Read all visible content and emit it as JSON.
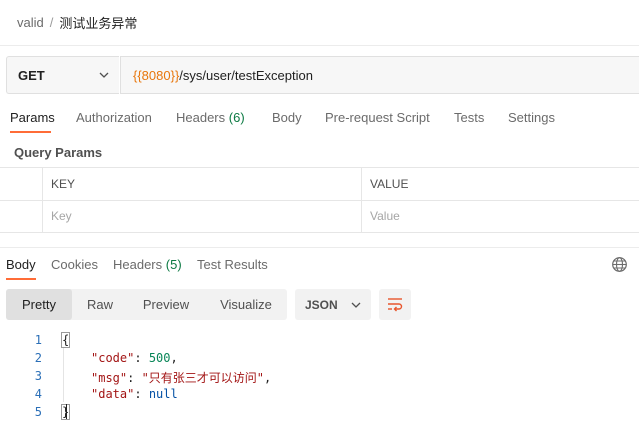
{
  "breadcrumb": {
    "parent": "valid",
    "separator": "/",
    "current": "测试业务异常"
  },
  "request": {
    "method": "GET",
    "url_variable": "{{8080}}",
    "url_path": "/sys/user/testException"
  },
  "request_tabs": [
    {
      "label": "Params"
    },
    {
      "label": "Authorization"
    },
    {
      "label": "Headers",
      "count": "(6)"
    },
    {
      "label": "Body"
    },
    {
      "label": "Pre-request Script"
    },
    {
      "label": "Tests"
    },
    {
      "label": "Settings"
    }
  ],
  "query_params": {
    "title": "Query Params",
    "columns": [
      "KEY",
      "VALUE"
    ],
    "placeholders": [
      "Key",
      "Value"
    ]
  },
  "response_tabs": [
    {
      "label": "Body"
    },
    {
      "label": "Cookies"
    },
    {
      "label": "Headers",
      "count": "(5)"
    },
    {
      "label": "Test Results"
    }
  ],
  "format_buttons": [
    "Pretty",
    "Raw",
    "Preview",
    "Visualize"
  ],
  "format_select": "JSON",
  "code": {
    "line_numbers": [
      "1",
      "2",
      "3",
      "4",
      "5"
    ],
    "open_brace": "{",
    "close_brace": "}",
    "lines": [
      {
        "key": "\"code\"",
        "colon": ": ",
        "value": "500",
        "tail": ","
      },
      {
        "key": "\"msg\"",
        "colon": ": ",
        "value": "\"只有张三才可以访问\"",
        "tail": ","
      },
      {
        "key": "\"data\"",
        "colon": ": ",
        "value": "null",
        "tail": ""
      }
    ]
  },
  "icons": {
    "method_chevron": "chevron-down-icon",
    "json_chevron": "chevron-down-icon",
    "wrap": "wrap-lines-icon",
    "globe": "globe-icon"
  },
  "colors": {
    "accent": "#ff6c37",
    "url_variable": "#e8770d",
    "count_green": "#0c7a43",
    "wrap_icon": "#e8552c"
  }
}
